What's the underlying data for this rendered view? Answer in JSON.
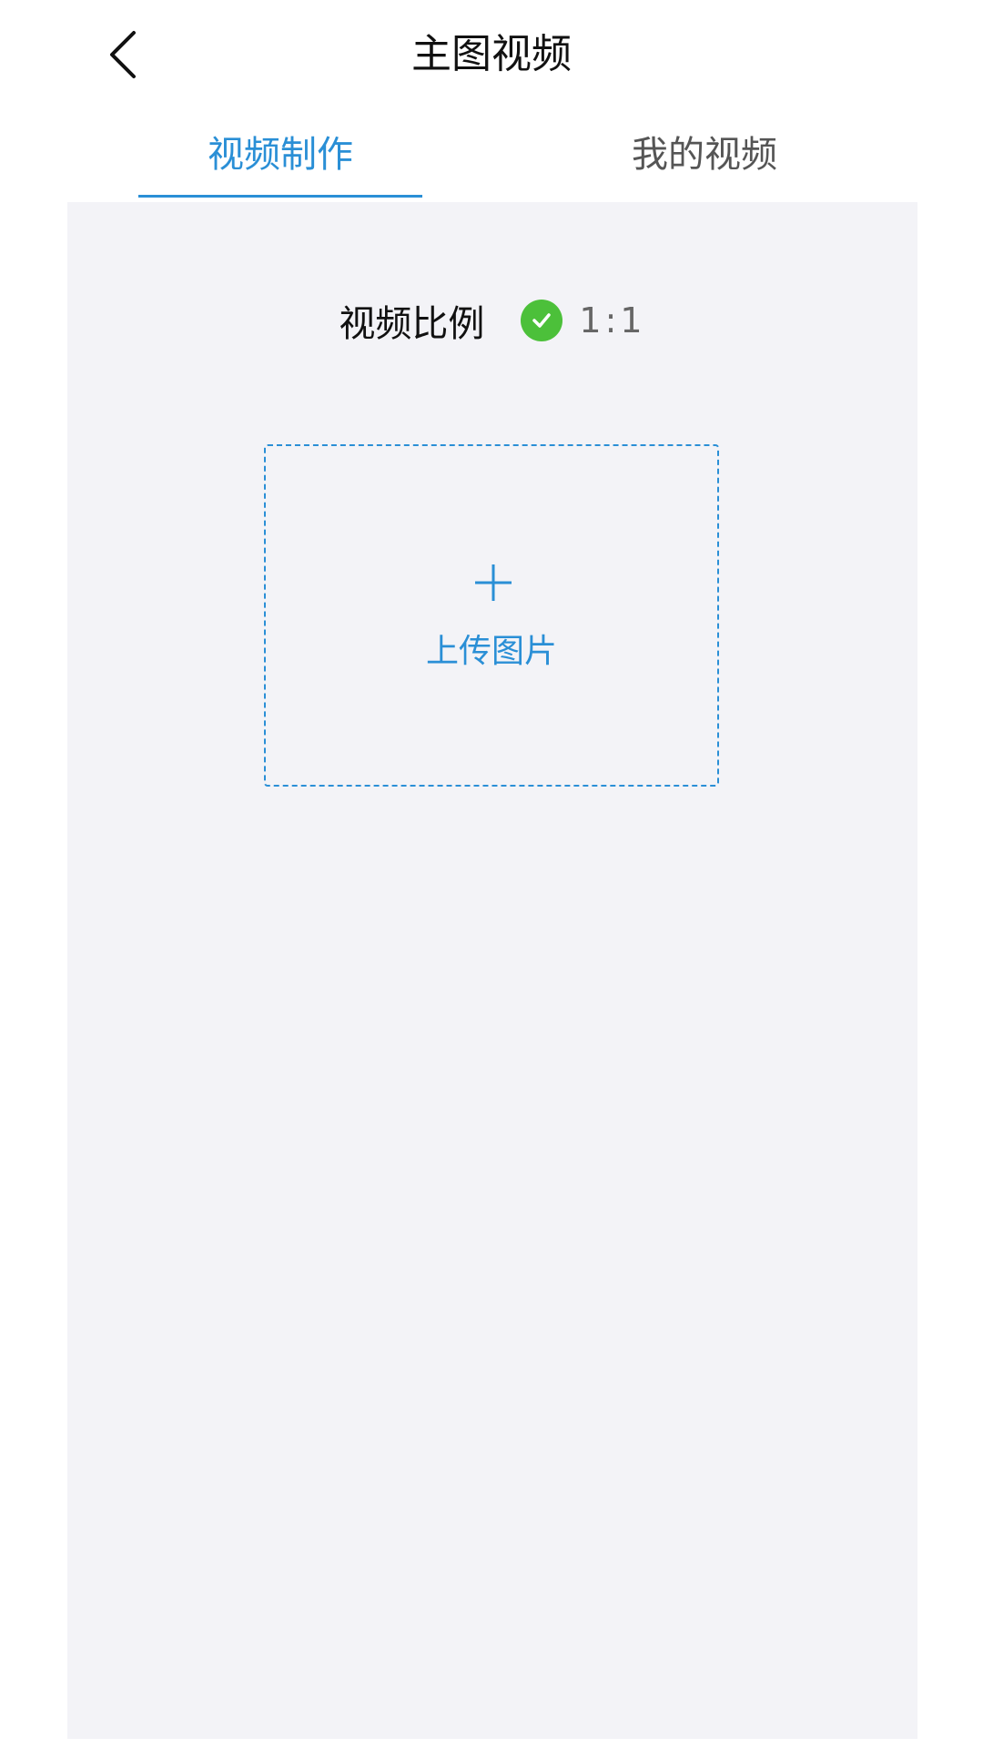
{
  "header": {
    "title": "主图视频",
    "back_icon": "chevron-left-icon"
  },
  "tabs": [
    {
      "label": "视频制作",
      "active": true
    },
    {
      "label": "我的视频",
      "active": false
    }
  ],
  "ratio": {
    "label": "视频比例",
    "option_value": "1:1",
    "selected": true,
    "check_icon": "check-circle-icon"
  },
  "upload": {
    "label": "上传图片",
    "icon": "plus-icon"
  },
  "colors": {
    "accent": "#2a8fd6",
    "check": "#4cc03a",
    "panel_bg": "#f3f3f7"
  }
}
